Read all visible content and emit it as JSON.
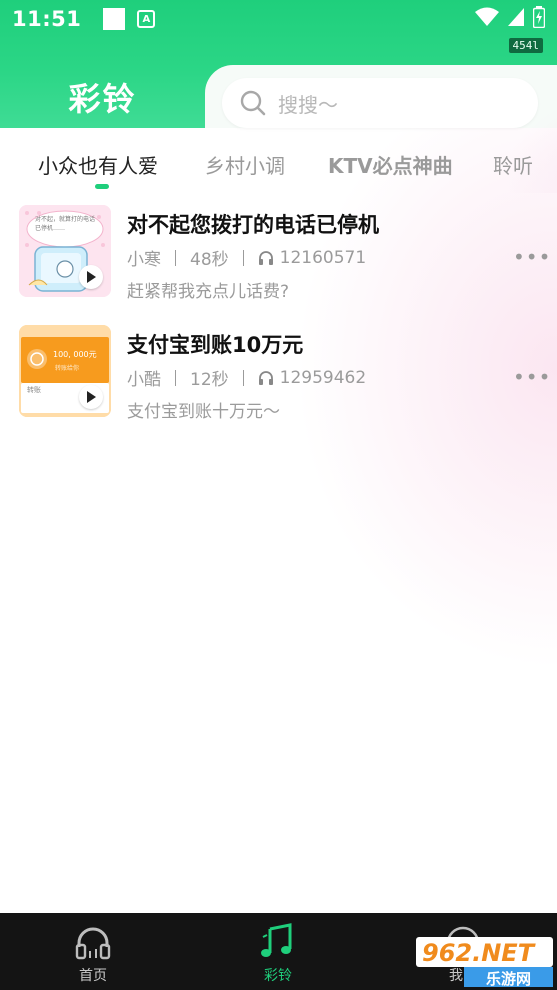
{
  "status_bar": {
    "time": "11:51",
    "network_badge": "454l"
  },
  "header": {
    "title": "彩铃",
    "search_placeholder": "搜搜～"
  },
  "tabs": [
    "小众也有人爱",
    "乡村小调",
    "KTV必点神曲",
    "聆听"
  ],
  "active_tab_index": 0,
  "items": [
    {
      "title": "对不起您拨打的电话已停机",
      "author": "小寒",
      "duration": "48秒",
      "plays": "12160571",
      "desc": "赶紧帮我充点儿话费?",
      "thumb_text": "对不起，就算打的电话已停机……"
    },
    {
      "title": "支付宝到账10万元",
      "author": "小酷",
      "duration": "12秒",
      "plays": "12959462",
      "desc": "支付宝到账十万元～",
      "thumb_text_amount": "100, 000元",
      "thumb_text_sub": "转账给你",
      "thumb_text_btn": "转账"
    }
  ],
  "bottom_nav": [
    {
      "label": "首页",
      "icon": "headphones-icon"
    },
    {
      "label": "彩铃",
      "icon": "music-note-icon"
    },
    {
      "label": "我的",
      "icon": "profile-icon"
    }
  ],
  "watermark": {
    "brand": "962.NET",
    "sub": "乐游网"
  },
  "colors": {
    "accent": "#1fcf7c",
    "nav_bg": "#141414"
  }
}
